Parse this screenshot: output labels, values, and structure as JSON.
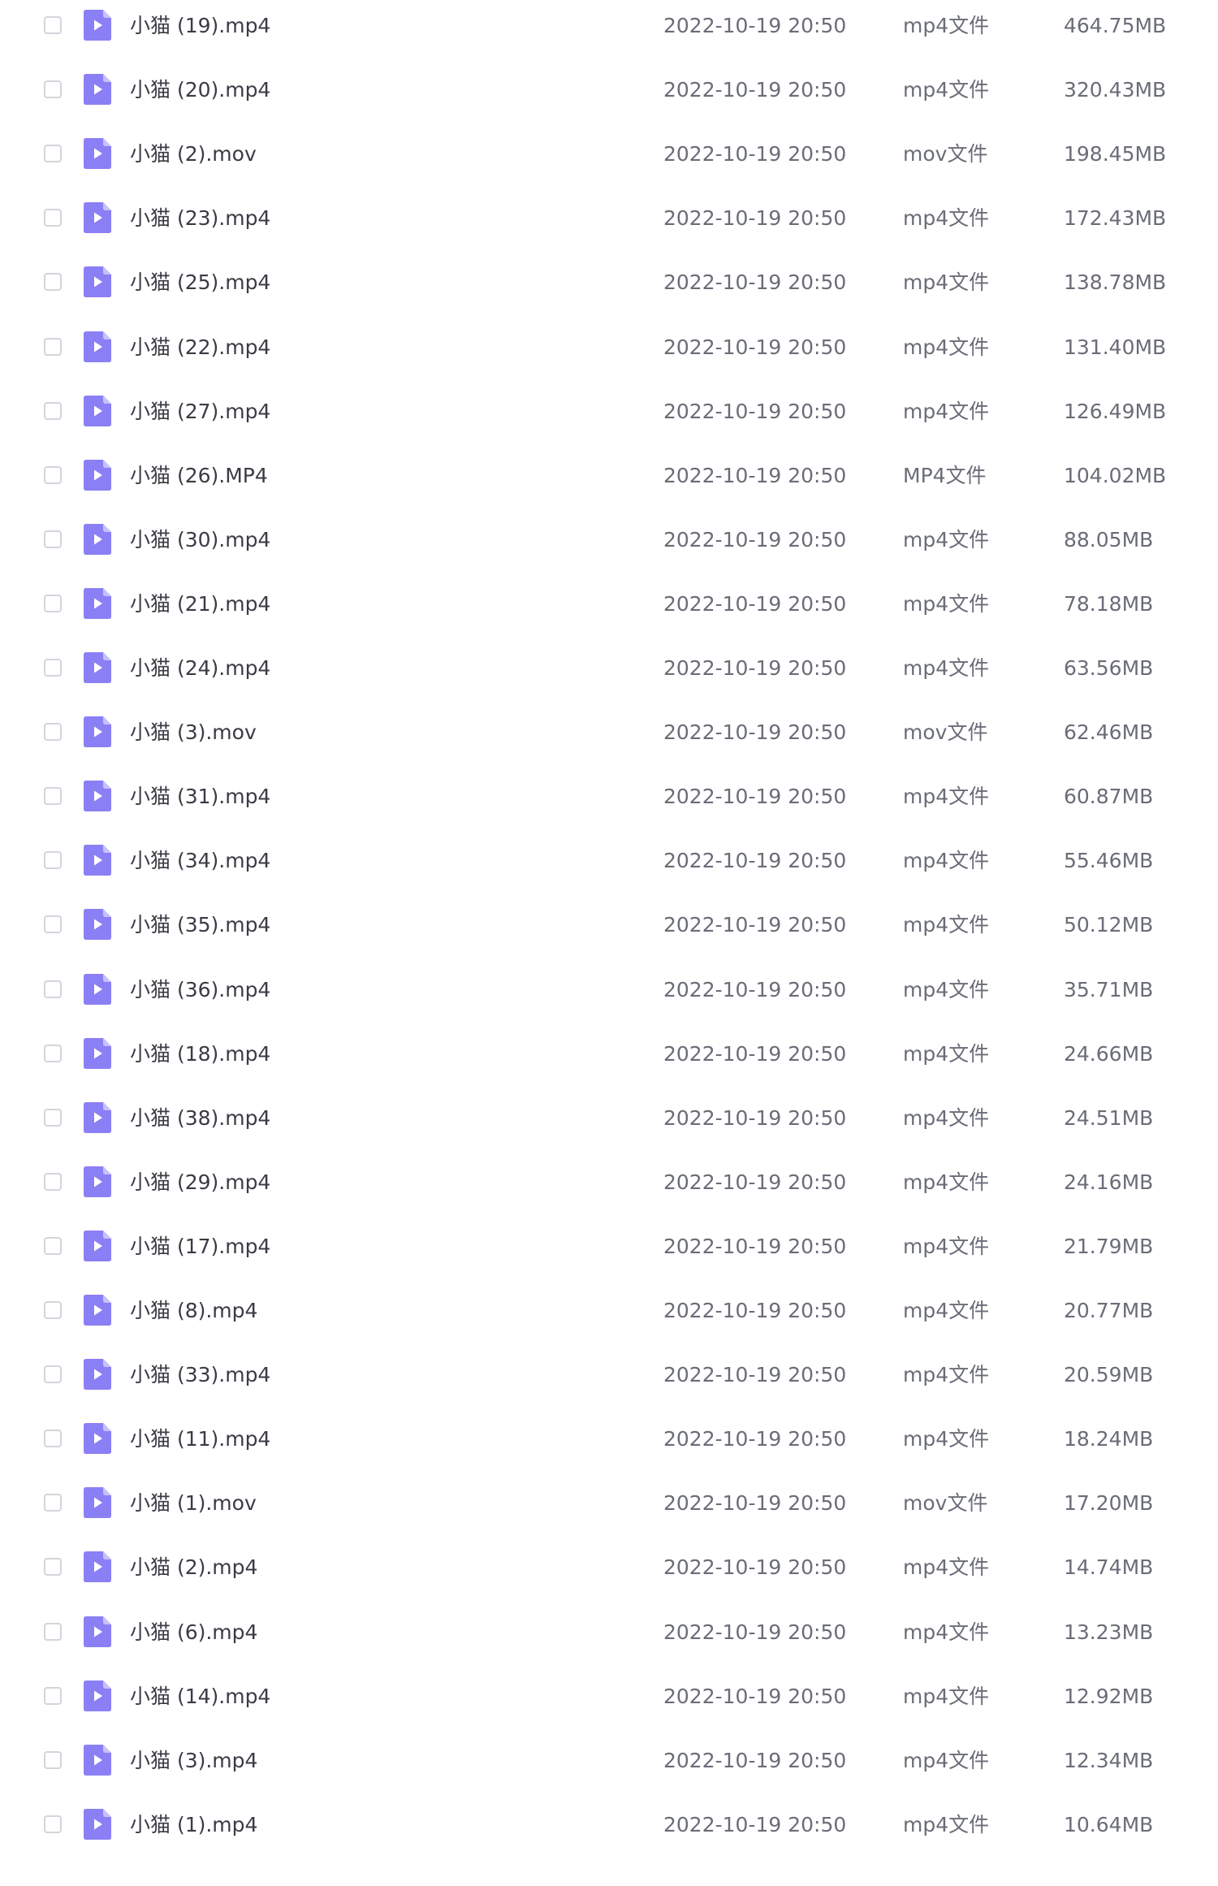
{
  "files": [
    {
      "name": "小猫 (19).mp4",
      "date": "2022-10-19 20:50",
      "type": "mp4文件",
      "size": "464.75MB"
    },
    {
      "name": "小猫 (20).mp4",
      "date": "2022-10-19 20:50",
      "type": "mp4文件",
      "size": "320.43MB"
    },
    {
      "name": "小猫 (2).mov",
      "date": "2022-10-19 20:50",
      "type": "mov文件",
      "size": "198.45MB"
    },
    {
      "name": "小猫 (23).mp4",
      "date": "2022-10-19 20:50",
      "type": "mp4文件",
      "size": "172.43MB"
    },
    {
      "name": "小猫 (25).mp4",
      "date": "2022-10-19 20:50",
      "type": "mp4文件",
      "size": "138.78MB"
    },
    {
      "name": "小猫 (22).mp4",
      "date": "2022-10-19 20:50",
      "type": "mp4文件",
      "size": "131.40MB"
    },
    {
      "name": "小猫 (27).mp4",
      "date": "2022-10-19 20:50",
      "type": "mp4文件",
      "size": "126.49MB"
    },
    {
      "name": "小猫 (26).MP4",
      "date": "2022-10-19 20:50",
      "type": "MP4文件",
      "size": "104.02MB"
    },
    {
      "name": "小猫 (30).mp4",
      "date": "2022-10-19 20:50",
      "type": "mp4文件",
      "size": "88.05MB"
    },
    {
      "name": "小猫 (21).mp4",
      "date": "2022-10-19 20:50",
      "type": "mp4文件",
      "size": "78.18MB"
    },
    {
      "name": "小猫 (24).mp4",
      "date": "2022-10-19 20:50",
      "type": "mp4文件",
      "size": "63.56MB"
    },
    {
      "name": "小猫 (3).mov",
      "date": "2022-10-19 20:50",
      "type": "mov文件",
      "size": "62.46MB"
    },
    {
      "name": "小猫 (31).mp4",
      "date": "2022-10-19 20:50",
      "type": "mp4文件",
      "size": "60.87MB"
    },
    {
      "name": "小猫 (34).mp4",
      "date": "2022-10-19 20:50",
      "type": "mp4文件",
      "size": "55.46MB"
    },
    {
      "name": "小猫 (35).mp4",
      "date": "2022-10-19 20:50",
      "type": "mp4文件",
      "size": "50.12MB"
    },
    {
      "name": "小猫 (36).mp4",
      "date": "2022-10-19 20:50",
      "type": "mp4文件",
      "size": "35.71MB"
    },
    {
      "name": "小猫 (18).mp4",
      "date": "2022-10-19 20:50",
      "type": "mp4文件",
      "size": "24.66MB"
    },
    {
      "name": "小猫 (38).mp4",
      "date": "2022-10-19 20:50",
      "type": "mp4文件",
      "size": "24.51MB"
    },
    {
      "name": "小猫 (29).mp4",
      "date": "2022-10-19 20:50",
      "type": "mp4文件",
      "size": "24.16MB"
    },
    {
      "name": "小猫 (17).mp4",
      "date": "2022-10-19 20:50",
      "type": "mp4文件",
      "size": "21.79MB"
    },
    {
      "name": "小猫 (8).mp4",
      "date": "2022-10-19 20:50",
      "type": "mp4文件",
      "size": "20.77MB"
    },
    {
      "name": "小猫 (33).mp4",
      "date": "2022-10-19 20:50",
      "type": "mp4文件",
      "size": "20.59MB"
    },
    {
      "name": "小猫 (11).mp4",
      "date": "2022-10-19 20:50",
      "type": "mp4文件",
      "size": "18.24MB"
    },
    {
      "name": "小猫 (1).mov",
      "date": "2022-10-19 20:50",
      "type": "mov文件",
      "size": "17.20MB"
    },
    {
      "name": "小猫 (2).mp4",
      "date": "2022-10-19 20:50",
      "type": "mp4文件",
      "size": "14.74MB"
    },
    {
      "name": "小猫 (6).mp4",
      "date": "2022-10-19 20:50",
      "type": "mp4文件",
      "size": "13.23MB"
    },
    {
      "name": "小猫 (14).mp4",
      "date": "2022-10-19 20:50",
      "type": "mp4文件",
      "size": "12.92MB"
    },
    {
      "name": "小猫 (3).mp4",
      "date": "2022-10-19 20:50",
      "type": "mp4文件",
      "size": "12.34MB"
    },
    {
      "name": "小猫 (1).mp4",
      "date": "2022-10-19 20:50",
      "type": "mp4文件",
      "size": "10.64MB"
    }
  ],
  "colors": {
    "icon_fill": "#8b7ff5",
    "icon_fold": "#c7c0fb",
    "text_primary": "#3b3b45",
    "text_secondary": "#6a6d78",
    "checkbox_border": "#d3d5dc"
  },
  "icons": {
    "file": "video-file-icon",
    "checkbox": "checkbox"
  }
}
